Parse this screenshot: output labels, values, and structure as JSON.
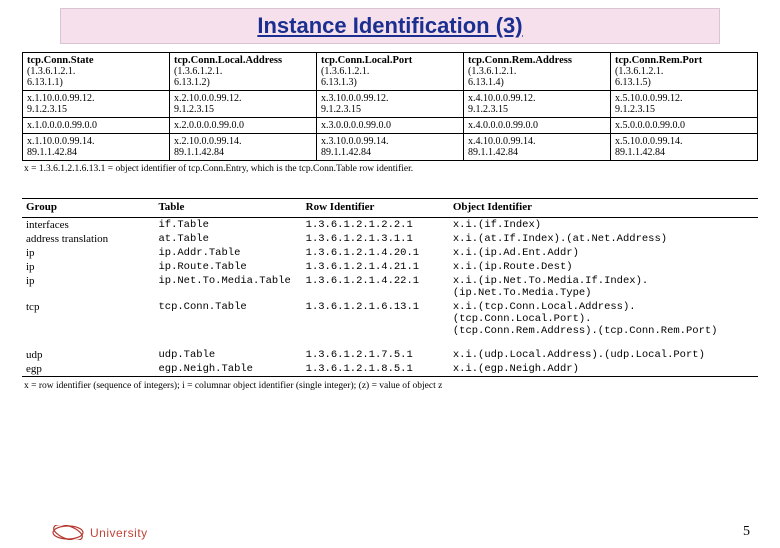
{
  "title": "Instance Identification (3)",
  "tcp_table": {
    "headers": [
      {
        "name": "tcp.Conn.State",
        "oid": "(1.3.6.1.2.1.\n6.13.1.1)"
      },
      {
        "name": "tcp.Conn.Local.Address",
        "oid": "(1.3.6.1.2.1.\n6.13.1.2)"
      },
      {
        "name": "tcp.Conn.Local.Port",
        "oid": "(1.3.6.1.2.1.\n6.13.1.3)"
      },
      {
        "name": "tcp.Conn.Rem.Address",
        "oid": "(1.3.6.1.2.1.\n6.13.1.4)"
      },
      {
        "name": "tcp.Conn.Rem.Port",
        "oid": "(1.3.6.1.2.1.\n6.13.1.5)"
      }
    ],
    "rows": [
      [
        "x.1.10.0.0.99.12.\n9.1.2.3.15",
        "x.2.10.0.0.99.12.\n9.1.2.3.15",
        "x.3.10.0.0.99.12.\n9.1.2.3.15",
        "x.4.10.0.0.99.12.\n9.1.2.3.15",
        "x.5.10.0.0.99.12.\n9.1.2.3.15"
      ],
      [
        "x.1.0.0.0.0.99.0.0",
        "x.2.0.0.0.0.99.0.0",
        "x.3.0.0.0.0.99.0.0",
        "x.4.0.0.0.0.99.0.0",
        "x.5.0.0.0.0.99.0.0"
      ],
      [
        "x.1.10.0.0.99.14.\n89.1.1.42.84",
        "x.2.10.0.0.99.14.\n89.1.1.42.84",
        "x.3.10.0.0.99.14.\n89.1.1.42.84",
        "x.4.10.0.0.99.14.\n89.1.1.42.84",
        "x.5.10.0.0.99.14.\n89.1.1.42.84"
      ]
    ]
  },
  "footnote1": "x = 1.3.6.1.2.1.6.13.1 = object identifier of tcp.Conn.Entry, which is the tcp.Conn.Table row identifier.",
  "group_table": {
    "headers": [
      "Group",
      "Table",
      "Row Identifier",
      "Object Identifier"
    ],
    "rows": [
      {
        "group": "interfaces",
        "table": "if.Table",
        "rowid": "1.3.6.1.2.1.2.2.1",
        "objid": "x.i.(if.Index)"
      },
      {
        "group": "address translation",
        "table": "at.Table",
        "rowid": "1.3.6.1.2.1.3.1.1",
        "objid": "x.i.(at.If.Index).(at.Net.Address)"
      },
      {
        "group": "ip",
        "table": "ip.Addr.Table",
        "rowid": "1.3.6.1.2.1.4.20.1",
        "objid": "x.i.(ip.Ad.Ent.Addr)"
      },
      {
        "group": "ip",
        "table": "ip.Route.Table",
        "rowid": "1.3.6.1.2.1.4.21.1",
        "objid": "x.i.(ip.Route.Dest)"
      },
      {
        "group": "ip",
        "table": "ip.Net.To.Media.Table",
        "rowid": "1.3.6.1.2.1.4.22.1",
        "objid": "x.i.(ip.Net.To.Media.If.Index).(ip.Net.To.Media.Type)"
      },
      {
        "group": "tcp",
        "table": "tcp.Conn.Table",
        "rowid": "1.3.6.1.2.1.6.13.1",
        "objid": "x.i.(tcp.Conn.Local.Address).(tcp.Conn.Local.Port).\n(tcp.Conn.Rem.Address).(tcp.Conn.Rem.Port)"
      },
      {
        "group": "udp",
        "table": "udp.Table",
        "rowid": "1.3.6.1.2.1.7.5.1",
        "objid": "x.i.(udp.Local.Address).(udp.Local.Port)"
      },
      {
        "group": "egp",
        "table": "egp.Neigh.Table",
        "rowid": "1.3.6.1.2.1.8.5.1",
        "objid": "x.i.(egp.Neigh.Addr)"
      }
    ]
  },
  "footnote2": "x = row identifier (sequence of integers); i = columnar object identifier (single integer); (z) = value of object z",
  "footer": {
    "university": "University",
    "page": "5"
  }
}
